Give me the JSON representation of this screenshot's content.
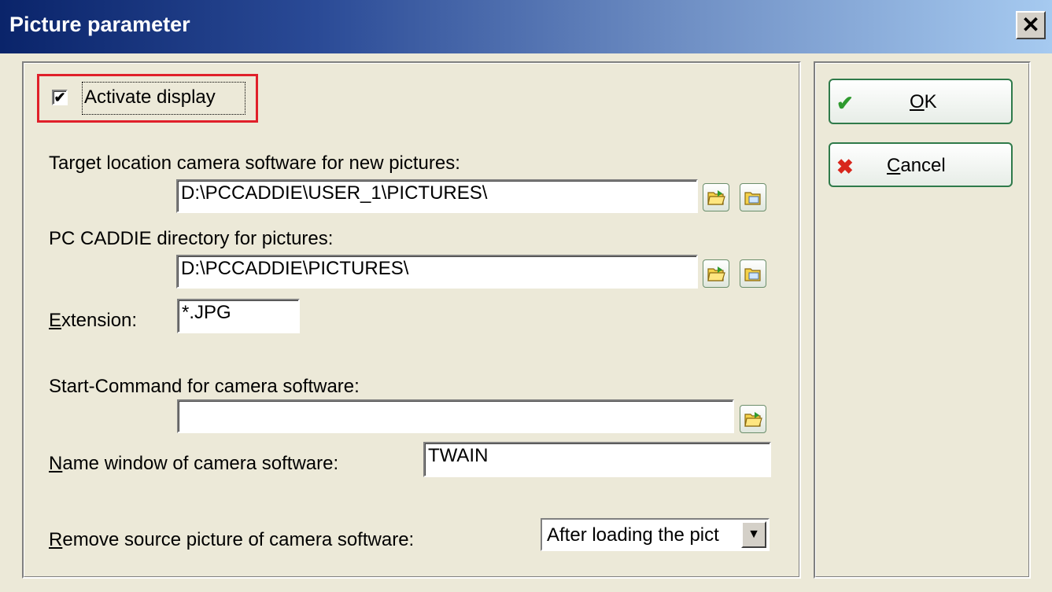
{
  "window": {
    "title": "Picture parameter",
    "close_glyph": "✕"
  },
  "activate_display": {
    "label": "Activate display",
    "checked": true,
    "check_glyph": "✔"
  },
  "target_location": {
    "label": "Target location camera software for new pictures:",
    "value": "D:\\PCCADDIE\\USER_1\\PICTURES\\"
  },
  "pccaddie_dir": {
    "label": "PC CADDIE directory for pictures:",
    "value": "D:\\PCCADDIE\\PICTURES\\"
  },
  "extension": {
    "label_mnemonic": "E",
    "label_rest": "xtension:",
    "value": "*.JPG"
  },
  "start_command": {
    "label": "Start-Command for camera software:",
    "value": ""
  },
  "name_window": {
    "label_mnemonic": "N",
    "label_rest": "ame window of camera software:",
    "value": "TWAIN"
  },
  "remove_source": {
    "label_mnemonic": "R",
    "label_rest": "emove source picture of camera software:",
    "selected": "After loading the pict"
  },
  "buttons": {
    "ok": {
      "mnemonic": "O",
      "rest": "K",
      "icon": "check-icon",
      "color": "#2e9a2e"
    },
    "cancel": {
      "mnemonic": "C",
      "rest": "ancel",
      "icon": "x-icon",
      "color": "#d8261c"
    }
  },
  "icons": {
    "browse": "folder-open-icon",
    "view": "folder-view-icon"
  },
  "colors": {
    "highlight": "#e0202a",
    "titlebar_start": "#0a246a",
    "titlebar_end": "#a6caf0"
  }
}
